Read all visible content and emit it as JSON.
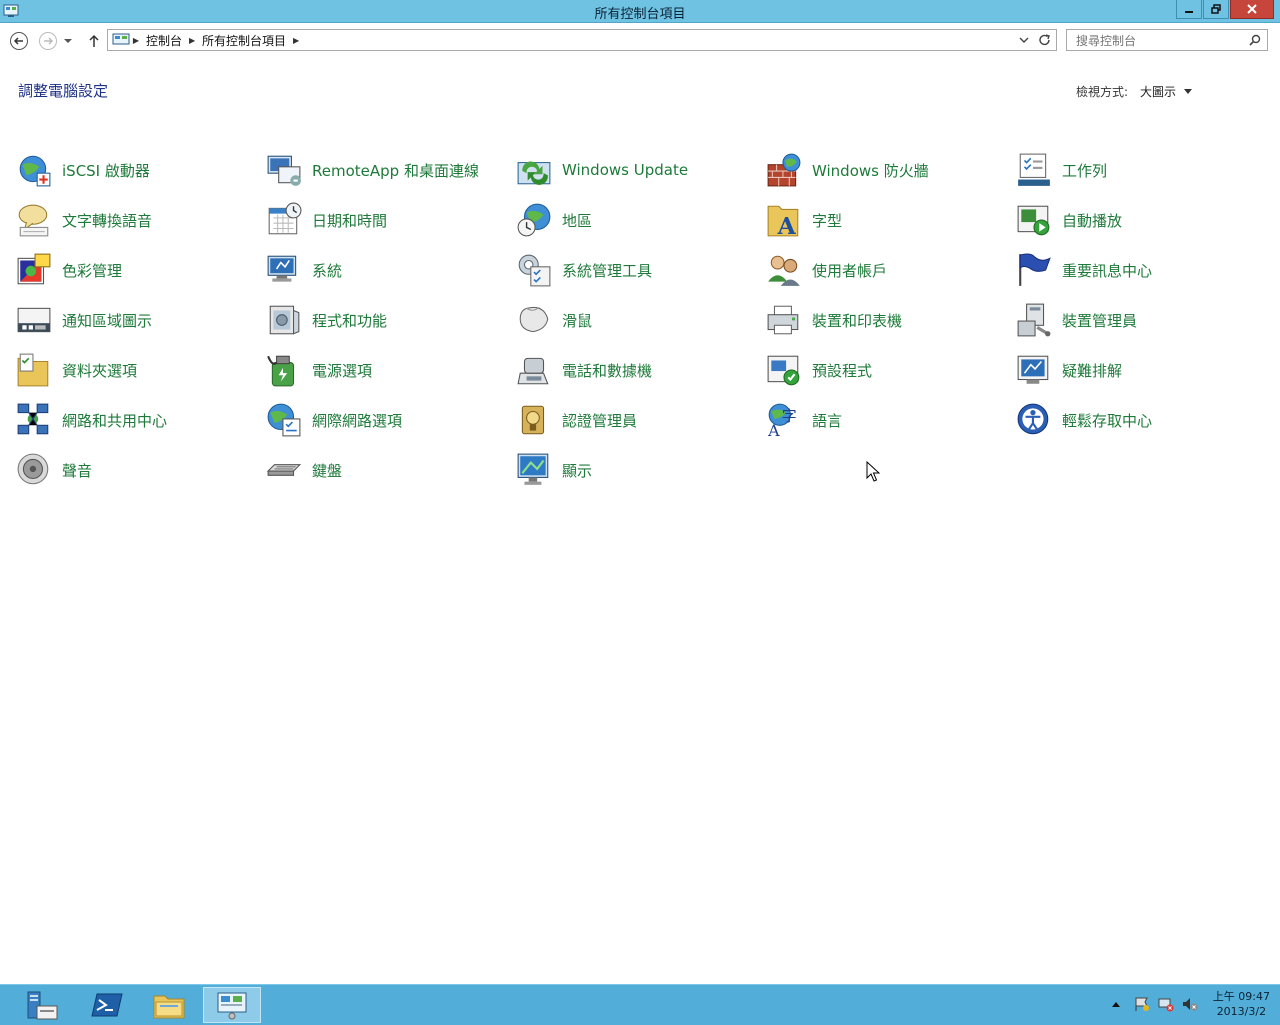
{
  "window": {
    "title": "所有控制台項目",
    "controls": [
      "minimize",
      "restore",
      "close"
    ]
  },
  "navigation": {
    "breadcrumb": [
      "控制台",
      "所有控制台項目"
    ],
    "search_placeholder": "搜尋控制台"
  },
  "header": {
    "title": "調整電腦設定",
    "view_by_label": "檢視方式:",
    "view_by_value": "大圖示"
  },
  "items": [
    {
      "label": "iSCSI 啟動器",
      "icon": "iscsi-globe-icon"
    },
    {
      "label": "RemoteApp 和桌面連線",
      "icon": "remoteapp-icon"
    },
    {
      "label": "Windows Update",
      "icon": "windows-update-icon"
    },
    {
      "label": "Windows 防火牆",
      "icon": "firewall-icon"
    },
    {
      "label": "工作列",
      "icon": "taskbar-icon"
    },
    {
      "label": "文字轉換語音",
      "icon": "speech-bubble-icon"
    },
    {
      "label": "日期和時間",
      "icon": "calendar-clock-icon"
    },
    {
      "label": "地區",
      "icon": "globe-clock-icon"
    },
    {
      "label": "字型",
      "icon": "font-folder-icon"
    },
    {
      "label": "自動播放",
      "icon": "autoplay-icon"
    },
    {
      "label": "色彩管理",
      "icon": "color-management-icon"
    },
    {
      "label": "系統",
      "icon": "system-icon"
    },
    {
      "label": "系統管理工具",
      "icon": "admin-tools-icon"
    },
    {
      "label": "使用者帳戶",
      "icon": "user-accounts-icon"
    },
    {
      "label": "重要訊息中心",
      "icon": "action-center-flag-icon"
    },
    {
      "label": "通知區域圖示",
      "icon": "notification-area-icon"
    },
    {
      "label": "程式和功能",
      "icon": "programs-features-icon"
    },
    {
      "label": "滑鼠",
      "icon": "mouse-icon"
    },
    {
      "label": "裝置和印表機",
      "icon": "printer-icon"
    },
    {
      "label": "裝置管理員",
      "icon": "device-manager-icon"
    },
    {
      "label": "資料夾選項",
      "icon": "folder-options-icon"
    },
    {
      "label": "電源選項",
      "icon": "power-options-icon"
    },
    {
      "label": "電話和數據機",
      "icon": "phone-modem-icon"
    },
    {
      "label": "預設程式",
      "icon": "default-programs-icon"
    },
    {
      "label": "疑難排解",
      "icon": "troubleshooting-icon"
    },
    {
      "label": "網路和共用中心",
      "icon": "network-sharing-icon"
    },
    {
      "label": "網際網路選項",
      "icon": "internet-options-icon"
    },
    {
      "label": "認證管理員",
      "icon": "credential-manager-icon"
    },
    {
      "label": "語言",
      "icon": "language-icon"
    },
    {
      "label": "輕鬆存取中心",
      "icon": "ease-of-access-icon"
    },
    {
      "label": "聲音",
      "icon": "speaker-icon"
    },
    {
      "label": "鍵盤",
      "icon": "keyboard-icon"
    },
    {
      "label": "顯示",
      "icon": "display-icon"
    }
  ],
  "taskbar": {
    "apps": [
      "server-manager-icon",
      "powershell-icon",
      "file-explorer-icon",
      "control-panel-icon"
    ],
    "active_app": "control-panel-icon",
    "time": "上午 09:47",
    "date": "2013/3/2"
  },
  "colors": {
    "titlebar": "#6fc2e2",
    "taskbar": "#52aed8",
    "link_green": "#1e7a3a",
    "header_blue": "#1e3287",
    "close_red": "#c7463b"
  }
}
